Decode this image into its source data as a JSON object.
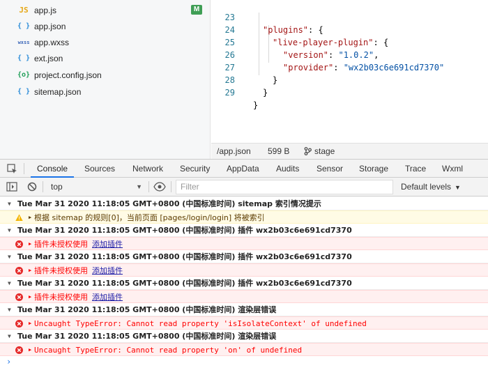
{
  "files": [
    {
      "icon": "JS",
      "name": "app.js",
      "badge": "M"
    },
    {
      "icon": "{ }",
      "name": "app.json"
    },
    {
      "icon": "wxss",
      "name": "app.wxss"
    },
    {
      "icon": "{ }",
      "name": "ext.json"
    },
    {
      "icon": "{o}",
      "name": "project.config.json"
    },
    {
      "icon": "{ }",
      "name": "sitemap.json"
    }
  ],
  "editor": {
    "lines": [
      {
        "num": "23",
        "key": "\"plugins\"",
        "rest": ": {"
      },
      {
        "num": "24",
        "key": "\"live-player-plugin\"",
        "rest": ": {"
      },
      {
        "num": "25",
        "key": "\"version\"",
        "rest": ": ",
        "val": "\"1.0.2\"",
        "tail": ","
      },
      {
        "num": "26",
        "key": "\"provider\"",
        "rest": ": ",
        "val": "\"wx2b03c6e691cd7370\"",
        "tail": ""
      },
      {
        "num": "27",
        "text": "}"
      },
      {
        "num": "28",
        "text": "}"
      },
      {
        "num": "29",
        "text": "}"
      }
    ]
  },
  "status": {
    "path": "/app.json",
    "size": "599 B",
    "branch": "stage"
  },
  "devtools": {
    "tabs": [
      "Console",
      "Sources",
      "Network",
      "Security",
      "AppData",
      "Audits",
      "Sensor",
      "Storage",
      "Trace",
      "Wxml"
    ],
    "context": "top",
    "filter_placeholder": "Filter",
    "levels": "Default levels"
  },
  "console": {
    "g1": "Tue Mar 31 2020 11:18:05 GMT+0800 (中国标准时间) sitemap 索引情况提示",
    "w1": "根据 sitemap 的规则[0]，当前页面 [pages/login/login] 将被索引",
    "g2": "Tue Mar 31 2020 11:18:05 GMT+0800 (中国标准时间) 插件 wx2b03c6e691cd7370",
    "e_plugin": "插件未授权使用",
    "add_plugin": "添加插件",
    "g3": "Tue Mar 31 2020 11:18:05 GMT+0800 (中国标准时间) 插件 wx2b03c6e691cd7370",
    "g4": "Tue Mar 31 2020 11:18:05 GMT+0800 (中国标准时间) 插件 wx2b03c6e691cd7370",
    "g5": "Tue Mar 31 2020 11:18:05 GMT+0800 (中国标准时间) 渲染层错误",
    "e5": "Uncaught TypeError: Cannot read property 'isIsolateContext' of undefined",
    "g6": "Tue Mar 31 2020 11:18:05 GMT+0800 (中国标准时间) 渲染层错误",
    "e6": "Uncaught TypeError: Cannot read property 'on' of undefined"
  }
}
